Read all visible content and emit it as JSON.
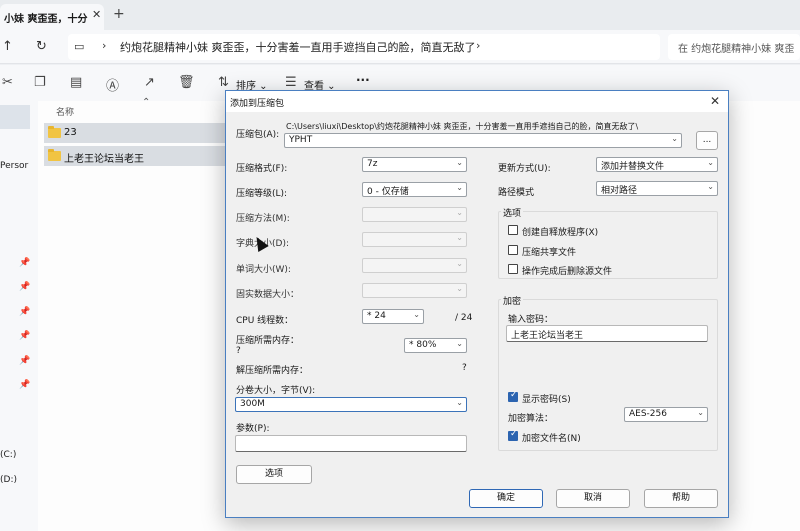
{
  "tab": {
    "title": "小妹 爽歪歪，十分"
  },
  "address": {
    "path": "约炮花腿精神小妹 爽歪歪，十分害羞一直用手遮挡自己的脸，简直无敌了",
    "search_placeholder": "在 约炮花腿精神小妹 爽歪"
  },
  "toolbar": {
    "sort_label": "排序",
    "view_label": "查看"
  },
  "sidebar": {
    "person_label": "Persor",
    "drive_c": "(C:)",
    "drive_d": "(D:)"
  },
  "filelist": {
    "column_name": "名称",
    "rows": [
      {
        "name": "23"
      },
      {
        "name": "上老王论坛当老王"
      }
    ]
  },
  "dialog": {
    "title": "添加到压缩包",
    "archive_label": "压缩包(A):",
    "archive_path": "C:\\Users\\liuxi\\Desktop\\约炮花腿精神小妹 爽歪歪，十分害羞一直用手遮挡自己的脸，简直无敌了\\",
    "archive_name": "YPHT",
    "browse_label": "...",
    "format_label": "压缩格式(F):",
    "format_value": "7z",
    "level_label": "压缩等级(L):",
    "level_value": "0 - 仅存储",
    "method_label": "压缩方法(M):",
    "dict_label": "字典大小(D):",
    "word_label": "单词大小(W):",
    "solid_label": "固实数据大小：",
    "cpu_label": "CPU 线程数：",
    "cpu_value": "* 24",
    "cpu_total": "/ 24",
    "mem_comp_label": "压缩所需内存：",
    "mem_comp_q": "?",
    "mem_percent": "* 80%",
    "mem_decomp_label": "解压缩所需内存：",
    "mem_decomp_q": "?",
    "split_label": "分卷大小，字节(V):",
    "split_value": "300M",
    "params_label": "参数(P):",
    "params_value": "",
    "options_button": "选项",
    "update_label": "更新方式(U):",
    "update_value": "添加并替换文件",
    "path_mode_label": "路径模式",
    "path_mode_value": "相对路径",
    "options_group": "选项",
    "opt_sfx": "创建自释放程序(X)",
    "opt_shared": "压缩共享文件",
    "opt_delete": "操作完成后删除源文件",
    "encrypt_group": "加密",
    "password_label": "输入密码：",
    "password_value": "上老王论坛当老王",
    "show_password": "显示密码(S)",
    "enc_method_label": "加密算法：",
    "enc_method_value": "AES-256",
    "enc_names": "加密文件名(N)",
    "ok": "确定",
    "cancel": "取消",
    "help": "帮助"
  },
  "colors": {
    "accent": "#2c64b0",
    "folder": "#f1c443"
  }
}
